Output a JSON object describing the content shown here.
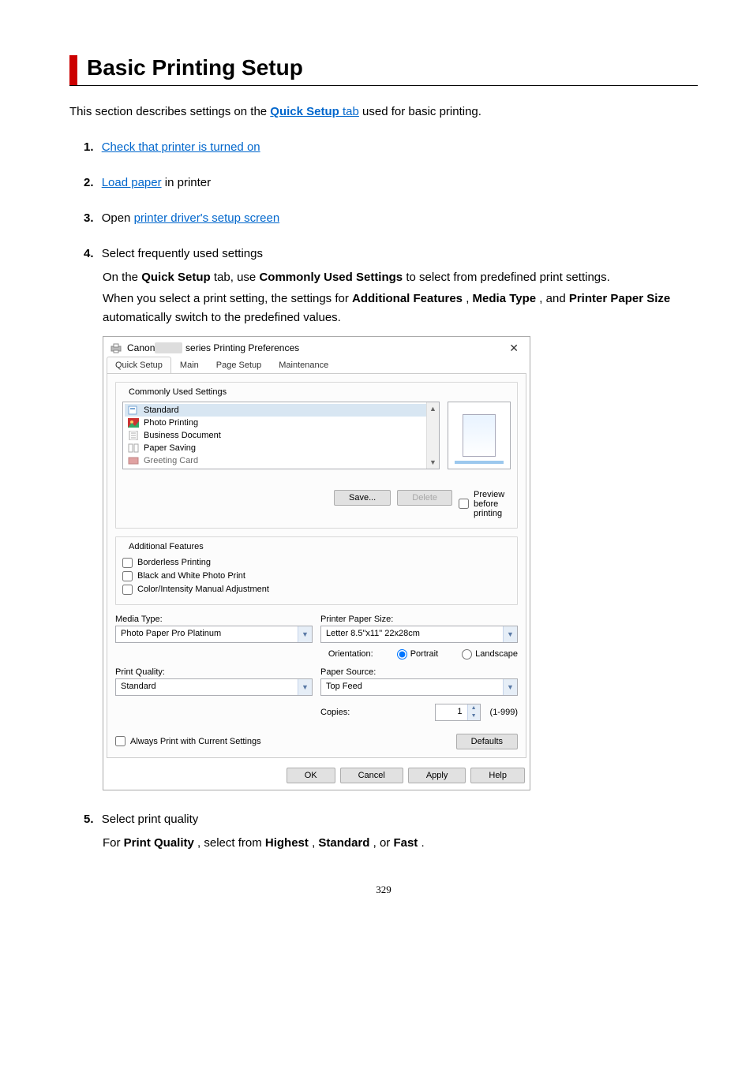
{
  "title": "Basic Printing Setup",
  "intro": {
    "pre": "This section describes settings on the ",
    "link": "Quick Setup tab",
    "link_pre": "Quick Setup",
    "link_suf": " tab",
    "post": " used for basic printing."
  },
  "steps": [
    {
      "num": "1.",
      "pre": "",
      "link": "Check that printer is turned on",
      "post": ""
    },
    {
      "num": "2.",
      "pre": "",
      "link": "Load paper",
      "post": " in printer"
    },
    {
      "num": "3.",
      "pre": "Open ",
      "link": "printer driver's setup screen",
      "post": ""
    },
    {
      "num": "4.",
      "text": "Select frequently used settings"
    },
    {
      "num": "5.",
      "text": "Select print quality"
    }
  ],
  "step4_body": {
    "p1_a": "On the ",
    "p1_b": "Quick Setup",
    "p1_c": " tab, use ",
    "p1_d": "Commonly Used Settings",
    "p1_e": " to select from predefined print settings.",
    "p2_a": "When you select a print setting, the settings for ",
    "p2_b": "Additional Features",
    "p2_c": ", ",
    "p2_d": "Media Type",
    "p2_e": ", and ",
    "p2_f": "Printer Paper Size",
    "p2_g": " automatically switch to the predefined values."
  },
  "step5_body": {
    "a": "For ",
    "b": "Print Quality",
    "c": ", select from ",
    "d": "Highest",
    "e": ", ",
    "f": "Standard",
    "g": ", or ",
    "h": "Fast",
    "i": "."
  },
  "dialog": {
    "title_pre": "Canon",
    "title_post": "series Printing Preferences",
    "close": "✕",
    "tabs": [
      "Quick Setup",
      "Main",
      "Page Setup",
      "Maintenance"
    ],
    "commonly_used": "Commonly Used Settings",
    "cu_items": [
      "Standard",
      "Photo Printing",
      "Business Document",
      "Paper Saving",
      "Greeting Card"
    ],
    "save": "Save...",
    "delete": "Delete",
    "preview_before": "Preview before printing",
    "additional": "Additional Features",
    "af_items": [
      "Borderless Printing",
      "Black and White Photo Print",
      "Color/Intensity Manual Adjustment"
    ],
    "media_type_lbl": "Media Type:",
    "media_type_val": "Photo Paper Pro Platinum",
    "paper_size_lbl": "Printer Paper Size:",
    "paper_size_val": "Letter 8.5\"x11\" 22x28cm",
    "orientation_lbl": "Orientation:",
    "portrait": "Portrait",
    "landscape": "Landscape",
    "print_quality_lbl": "Print Quality:",
    "print_quality_val": "Standard",
    "paper_source_lbl": "Paper Source:",
    "paper_source_val": "Top Feed",
    "copies_lbl": "Copies:",
    "copies_val": "1",
    "copies_range": "(1-999)",
    "always_print": "Always Print with Current Settings",
    "defaults": "Defaults",
    "ok": "OK",
    "cancel": "Cancel",
    "apply": "Apply",
    "help": "Help"
  },
  "pagenum": "329"
}
